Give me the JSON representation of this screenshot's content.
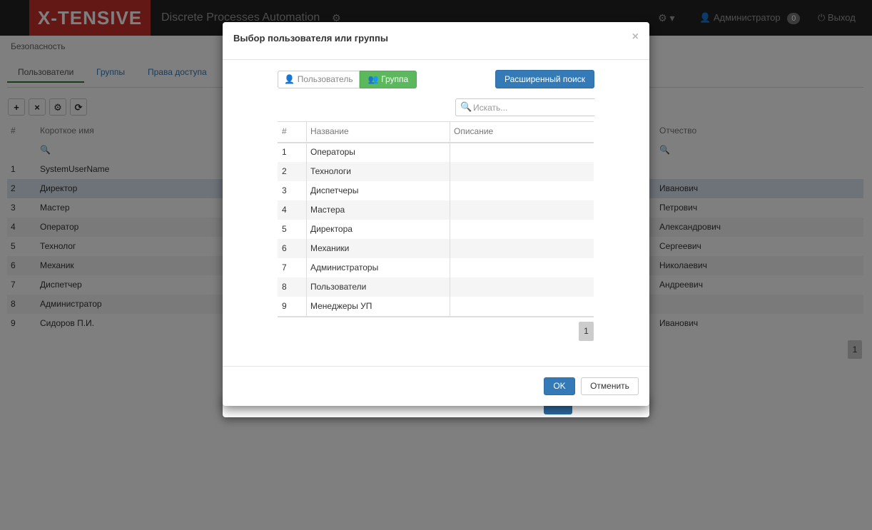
{
  "navbar": {
    "brand": "X-TENSIVE",
    "app_title": "Discrete Processes Automation",
    "modules_icon": "⚙",
    "settings_icon": "⚙ ▾",
    "user_icon": "👤",
    "user_name": "Администратор",
    "notifications_count": "0",
    "logout_icon": "⏻",
    "logout_label": "Выход"
  },
  "breadcrumb": "Безопасность",
  "tabs": [
    {
      "label": "Пользователи",
      "active": true
    },
    {
      "label": "Группы",
      "active": false
    },
    {
      "label": "Права доступа",
      "active": false
    }
  ],
  "toolbar": {
    "add": "+",
    "delete": "×",
    "settings": "⚙",
    "refresh": "⟳"
  },
  "users_table": {
    "columns": {
      "num": "#",
      "short_name": "Короткое имя",
      "patronymic": "Отчество"
    },
    "rows": [
      {
        "num": "1",
        "short_name": "SystemUserName",
        "patronymic": ""
      },
      {
        "num": "2",
        "short_name": "Директор",
        "patronymic": "Иванович"
      },
      {
        "num": "3",
        "short_name": "Мастер",
        "patronymic": "Петрович"
      },
      {
        "num": "4",
        "short_name": "Оператор",
        "patronymic": "Александрович"
      },
      {
        "num": "5",
        "short_name": "Технолог",
        "patronymic": "Сергеевич"
      },
      {
        "num": "6",
        "short_name": "Механик",
        "patronymic": "Николаевич"
      },
      {
        "num": "7",
        "short_name": "Диспетчер",
        "patronymic": "Андреевич"
      },
      {
        "num": "8",
        "short_name": "Администратор",
        "patronymic": ""
      },
      {
        "num": "9",
        "short_name": "Сидоров П.И.",
        "patronymic": "Иванович"
      }
    ],
    "page": "1"
  },
  "modal": {
    "title": "Выбор пользователя или группы",
    "close": "×",
    "toggle_user": "Пользователь",
    "toggle_group": "Группа",
    "advanced_search": "Расширенный поиск",
    "search_placeholder": "Искать...",
    "columns": {
      "num": "#",
      "name": "Название",
      "description": "Описание"
    },
    "groups": [
      {
        "num": "1",
        "name": "Операторы",
        "description": ""
      },
      {
        "num": "2",
        "name": "Технологи",
        "description": ""
      },
      {
        "num": "3",
        "name": "Диспетчеры",
        "description": ""
      },
      {
        "num": "4",
        "name": "Мастера",
        "description": ""
      },
      {
        "num": "5",
        "name": "Директора",
        "description": ""
      },
      {
        "num": "6",
        "name": "Механики",
        "description": ""
      },
      {
        "num": "7",
        "name": "Администраторы",
        "description": ""
      },
      {
        "num": "8",
        "name": "Пользователи",
        "description": ""
      },
      {
        "num": "9",
        "name": "Менеджеры УП",
        "description": ""
      }
    ],
    "page": "1",
    "ok": "OK",
    "cancel": "Отменить"
  }
}
